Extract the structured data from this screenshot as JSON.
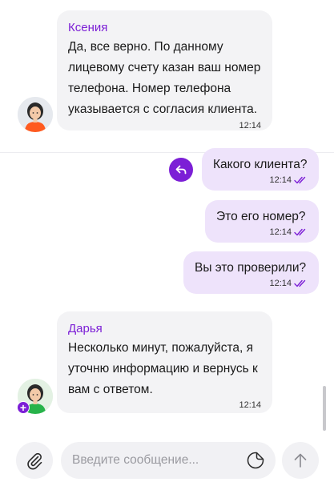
{
  "messages": [
    {
      "sender": "Ксения",
      "lines": [
        "Да, все верно. По данному",
        "лицевому счету казан ваш номер",
        "телефона. Номер телефона",
        "указывается с согласия клиента."
      ],
      "time": "12:14"
    },
    {
      "text": "Какого клиента?",
      "time": "12:14"
    },
    {
      "text": "Это его номер?",
      "time": "12:14"
    },
    {
      "text": "Вы это проверили?",
      "time": "12:14"
    },
    {
      "sender": "Дарья",
      "lines": [
        "Несколько минут, пожалуйста, я",
        "уточню информацию и вернусь к",
        "вам с ответом."
      ],
      "time": "12:14"
    }
  ],
  "composer": {
    "placeholder": "Введите сообщение..."
  },
  "colors": {
    "accent": "#7c1fd6",
    "bubble_in": "#f3f3f5",
    "bubble_out": "#eee3fb"
  },
  "icons": [
    "avatar-operator",
    "reply-icon",
    "double-check-icon",
    "paperclip-icon",
    "sticker-icon",
    "send-arrow-icon"
  ]
}
